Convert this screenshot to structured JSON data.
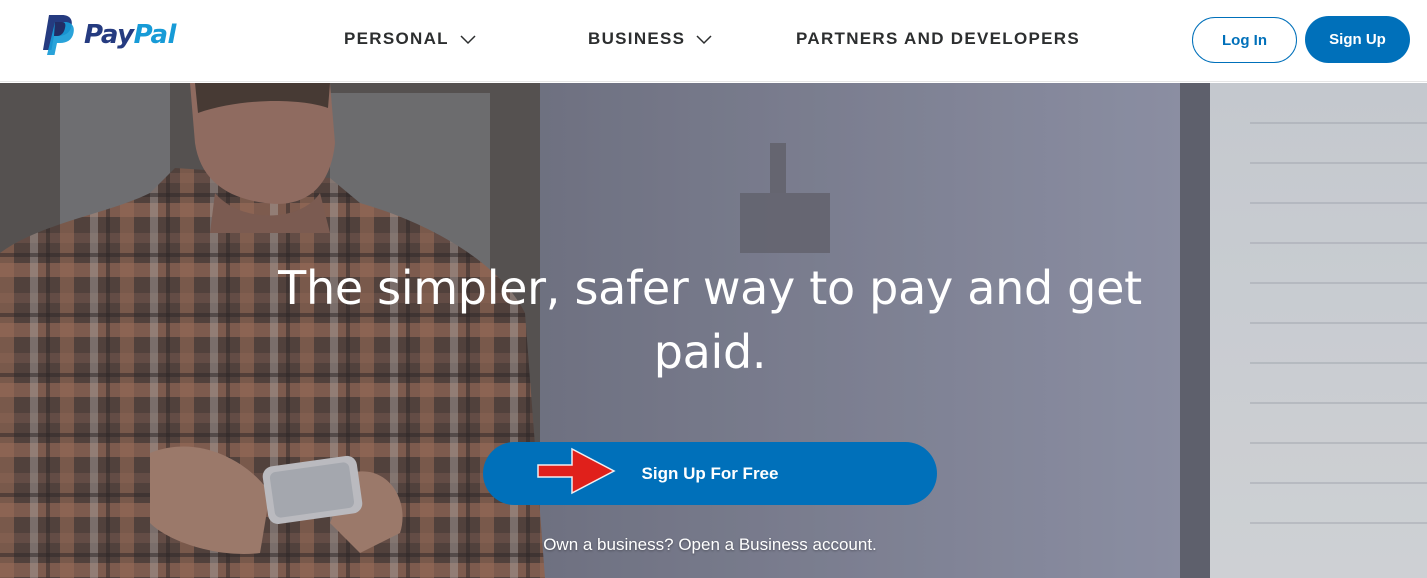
{
  "brand": {
    "name_part1": "Pay",
    "name_part2": "Pal",
    "colors": {
      "dark_blue": "#253b80",
      "light_blue": "#179bd7",
      "accent": "#0070ba"
    }
  },
  "nav": {
    "items": [
      {
        "label": "PERSONAL",
        "has_dropdown": true,
        "icon": "chevron-down-icon"
      },
      {
        "label": "BUSINESS",
        "has_dropdown": true,
        "icon": "chevron-down-icon"
      },
      {
        "label": "PARTNERS AND DEVELOPERS",
        "has_dropdown": false
      }
    ],
    "login_label": "Log In",
    "signup_label": "Sign Up"
  },
  "hero": {
    "headline": "The simpler, safer way to pay and get paid.",
    "cta_label": "Sign Up For Free",
    "annotation_icon": "red-arrow-icon",
    "subline_prefix": "Own a business?",
    "subline_link": "Open a Business account."
  }
}
